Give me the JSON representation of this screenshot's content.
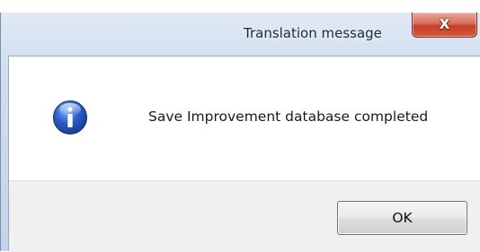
{
  "dialog": {
    "title": "Translation message",
    "message": "Save Improvement database completed",
    "icon": "info-icon",
    "close_glyph": "X",
    "ok_label": "OK"
  },
  "colors": {
    "close_button": "#c4402c",
    "info_icon": "#2a5cc7",
    "button_area": "#f0f0f0"
  }
}
